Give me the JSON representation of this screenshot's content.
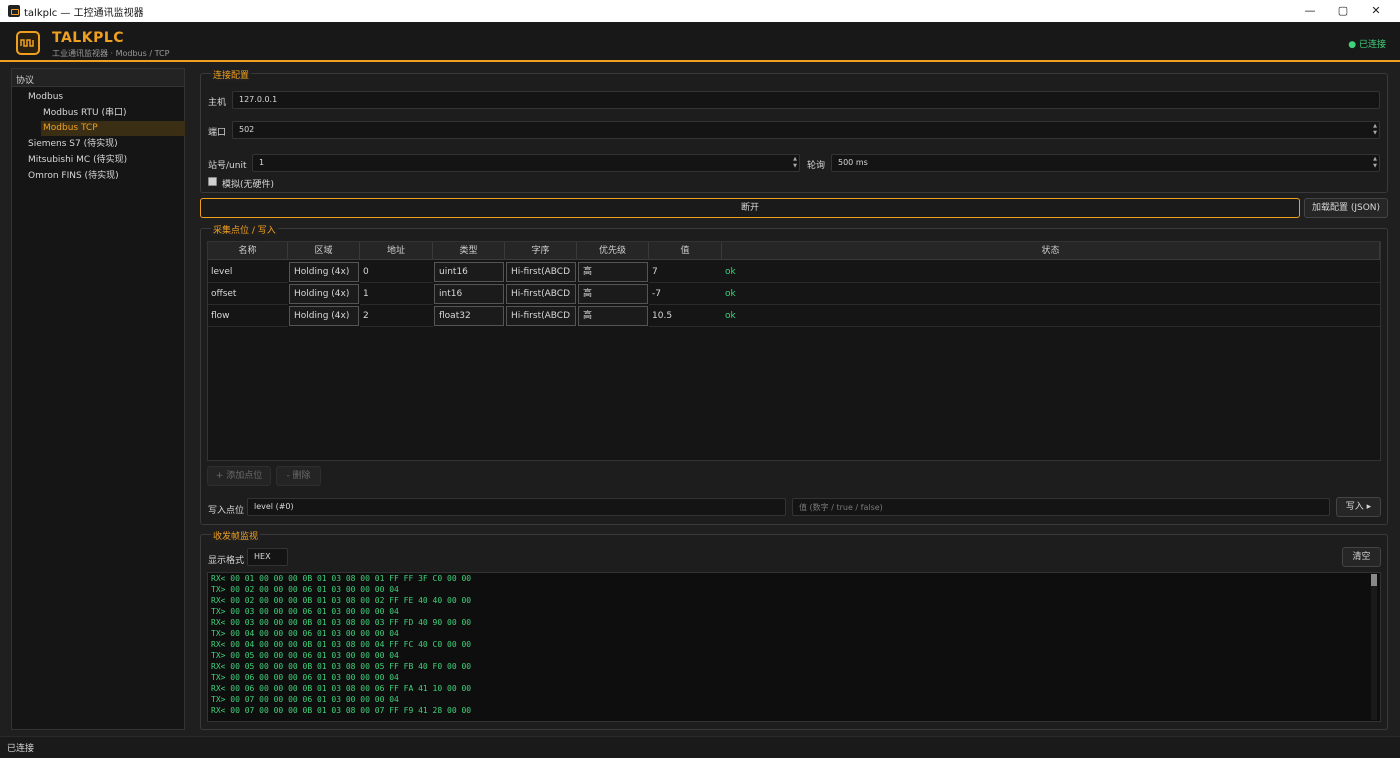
{
  "window": {
    "title": "talkplc — 工控通讯监视器",
    "controls": [
      "—",
      "▢",
      "✕"
    ]
  },
  "header": {
    "brand": "TALKPLC",
    "subtitle": "工业通讯监视器 · Modbus / TCP",
    "status": "● 已连接",
    "status_color": "#3fd27a",
    "accent": "#f0a020"
  },
  "sidebar": {
    "heading": "协议",
    "items": [
      {
        "label": "Modbus"
      },
      {
        "label": "Modbus RTU (串口)"
      },
      {
        "label": "Modbus TCP"
      },
      {
        "label": "Siemens S7 (待实现)"
      },
      {
        "label": "Mitsubishi MC (待实现)"
      },
      {
        "label": "Omron FINS (待实现)"
      }
    ],
    "selected": "Modbus TCP"
  },
  "connection": {
    "title": "连接配置",
    "host_label": "主机",
    "host_value": "127.0.0.1",
    "port_label": "端口",
    "port_value": "502",
    "unit_label": "站号/unit",
    "unit_value": "1",
    "poll_label": "轮询",
    "poll_value": "500 ms",
    "simulate_label": "模拟(无硬件)"
  },
  "actions": {
    "disconnect": "断开",
    "load_config": "加载配置 (JSON)"
  },
  "points": {
    "title": "采集点位 / 写入",
    "columns": [
      "名称",
      "区域",
      "地址",
      "类型",
      "字序",
      "优先级",
      "值",
      "状态"
    ],
    "rows": [
      {
        "name": "level",
        "area": "Holding (4x)",
        "addr": "0",
        "type": "uint16",
        "order": "Hi-first(ABCD",
        "priority": "高",
        "value": "7",
        "status": "ok"
      },
      {
        "name": "offset",
        "area": "Holding (4x)",
        "addr": "1",
        "type": "int16",
        "order": "Hi-first(ABCD",
        "priority": "高",
        "value": "-7",
        "status": "ok"
      },
      {
        "name": "flow",
        "area": "Holding (4x)",
        "addr": "2",
        "type": "float32",
        "order": "Hi-first(ABCD",
        "priority": "高",
        "value": "10.5",
        "status": "ok"
      }
    ],
    "add_button": "+ 添加点位",
    "delete_button": "- 删除",
    "write_label": "写入点位",
    "write_point": "level (#0)",
    "write_placeholder": "值 (数字 / true / false)",
    "write_button": "写入 ▸"
  },
  "monitor": {
    "title": "收发帧监视",
    "format_label": "显示格式",
    "format_value": "HEX",
    "clear_button": "清空",
    "lines": [
      "RX< 00 01 00 00 00 0B 01 03 08 00 01 FF FF 3F C0 00 00",
      "TX> 00 02 00 00 00 06 01 03 00 00 00 04",
      "RX< 00 02 00 00 00 0B 01 03 08 00 02 FF FE 40 40 00 00",
      "TX> 00 03 00 00 00 06 01 03 00 00 00 04",
      "RX< 00 03 00 00 00 0B 01 03 08 00 03 FF FD 40 90 00 00",
      "TX> 00 04 00 00 00 06 01 03 00 00 00 04",
      "RX< 00 04 00 00 00 0B 01 03 08 00 04 FF FC 40 C0 00 00",
      "TX> 00 05 00 00 00 06 01 03 00 00 00 04",
      "RX< 00 05 00 00 00 0B 01 03 08 00 05 FF FB 40 F0 00 00",
      "TX> 00 06 00 00 00 06 01 03 00 00 00 04",
      "RX< 00 06 00 00 00 0B 01 03 08 00 06 FF FA 41 10 00 00",
      "TX> 00 07 00 00 00 06 01 03 00 00 00 04",
      "RX< 00 07 00 00 00 0B 01 03 08 00 07 FF F9 41 28 00 00"
    ]
  },
  "statusbar": {
    "text": "已连接"
  }
}
